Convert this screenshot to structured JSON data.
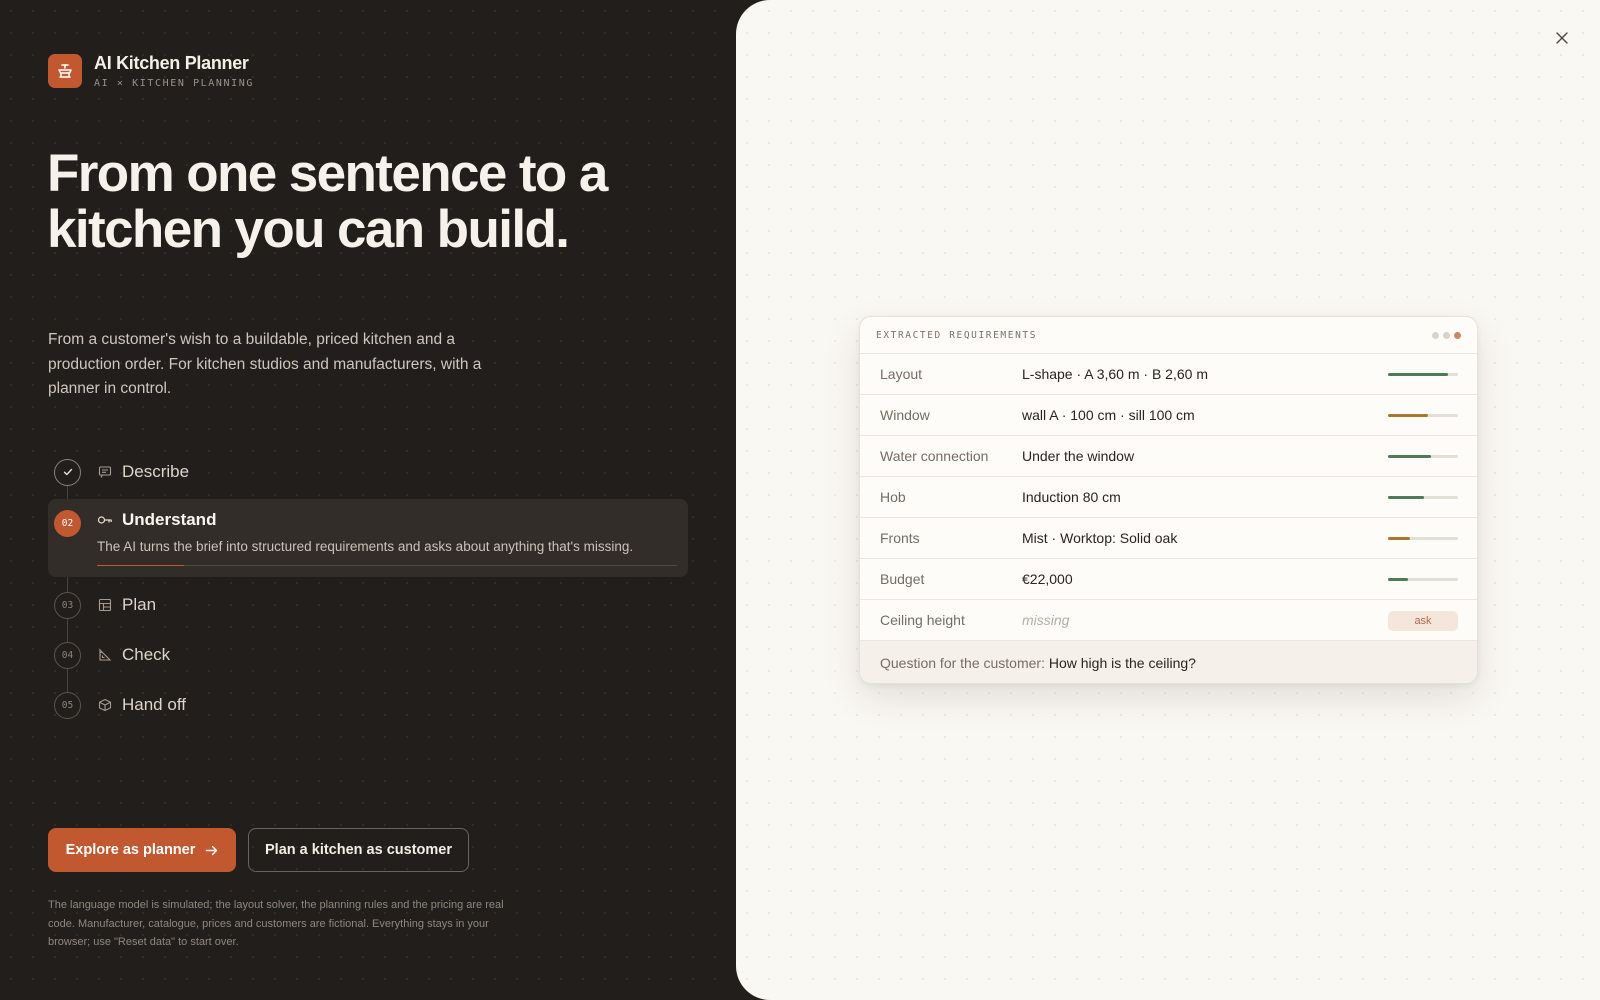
{
  "brand": {
    "title": "AI Kitchen Planner",
    "subtitle": "AI × KITCHEN PLANNING",
    "logo_icon": "kitchen-logo-icon",
    "accent": "#c2582f"
  },
  "hero": {
    "headline": "From one sentence to a kitchen you can build.",
    "subtext": "From a customer's wish to a buildable, priced kitchen and a production order. For kitchen studios and manufacturers, with a planner in control."
  },
  "steps": [
    {
      "number": "",
      "label": "Describe",
      "icon": "message-icon",
      "state": "done"
    },
    {
      "number": "02",
      "label": "Understand",
      "icon": "key-icon",
      "state": "active",
      "description": "The AI turns the brief into structured requirements and asks about anything that's missing.",
      "progress": 0.15
    },
    {
      "number": "03",
      "label": "Plan",
      "icon": "layout-icon",
      "state": "pending"
    },
    {
      "number": "04",
      "label": "Check",
      "icon": "set-square-icon",
      "state": "pending"
    },
    {
      "number": "05",
      "label": "Hand off",
      "icon": "box-icon",
      "state": "pending"
    }
  ],
  "actions": {
    "primary_label": "Explore as planner",
    "secondary_label": "Plan a kitchen as customer"
  },
  "disclaimer": "The language model is simulated; the layout solver, the planning rules and the pricing are real code. Manufacturer, catalogue, prices and customers are fictional. Everything stays in your browser; use \"Reset data\" to start over.",
  "card": {
    "title": "EXTRACTED REQUIREMENTS",
    "rows": [
      {
        "label": "Layout",
        "value": "L-shape · A 3,60 m · B 2,60 m",
        "confidence": 0.85,
        "color": "#4e7a55"
      },
      {
        "label": "Window",
        "value": "wall A · 100 cm · sill 100 cm",
        "confidence": 0.57,
        "color": "#a8772c"
      },
      {
        "label": "Water connection",
        "value": "Under the window",
        "confidence": 0.62,
        "color": "#4e7a55"
      },
      {
        "label": "Hob",
        "value": "Induction 80 cm",
        "confidence": 0.51,
        "color": "#4e7a55"
      },
      {
        "label": "Fronts",
        "value": "Mist · Worktop: Solid oak",
        "confidence": 0.32,
        "color": "#a8772c"
      },
      {
        "label": "Budget",
        "value": "€22,000",
        "confidence": 0.28,
        "color": "#4e7a55"
      },
      {
        "label": "Ceiling height",
        "value": "missing",
        "badge": "ask"
      }
    ],
    "footer_prefix": "Question for the customer: ",
    "footer_question": "How high is the ceiling?"
  }
}
